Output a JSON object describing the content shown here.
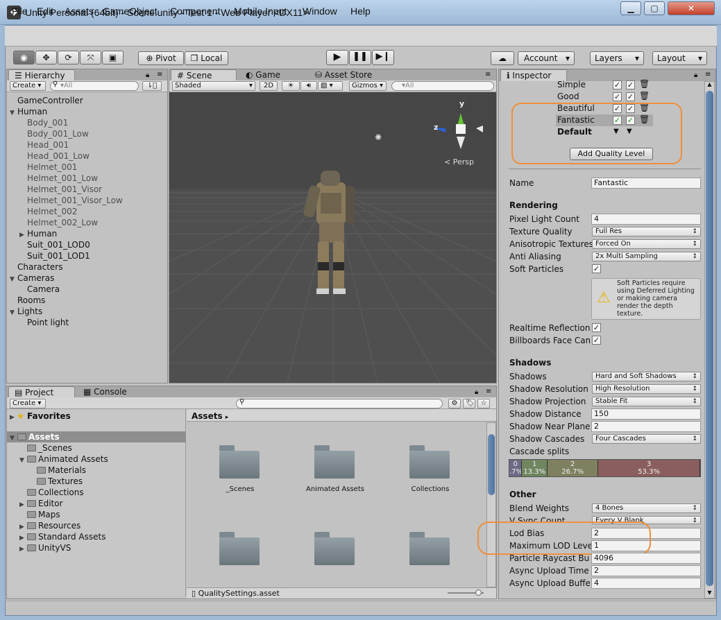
{
  "window": {
    "title": "Unity Personal (64bit) - Scene.unity - Test 1 - Web Player <DX11>",
    "minimize": "▁",
    "maximize": "▢",
    "close": "✕"
  },
  "menu": [
    "File",
    "Edit",
    "Assets",
    "GameObject",
    "Component",
    "Mobile Input",
    "Window",
    "Help"
  ],
  "toolbar": {
    "pivot": "Pivot",
    "local": "Local",
    "account": "Account",
    "layers": "Layers",
    "layout": "Layout"
  },
  "hierarchy": {
    "tab": "Hierarchy",
    "create": "Create",
    "search_placeholder": "▾All",
    "items": [
      {
        "label": "GameController",
        "indent": 0,
        "tri": ""
      },
      {
        "label": "Human",
        "indent": 0,
        "tri": "▼"
      },
      {
        "label": "Body_001",
        "indent": 2,
        "tri": "",
        "dim": true
      },
      {
        "label": "Body_001_Low",
        "indent": 2,
        "tri": "",
        "dim": true
      },
      {
        "label": "Head_001",
        "indent": 2,
        "tri": "",
        "dim": true
      },
      {
        "label": "Head_001_Low",
        "indent": 2,
        "tri": "",
        "dim": true
      },
      {
        "label": "Helmet_001",
        "indent": 2,
        "tri": "",
        "dim": true
      },
      {
        "label": "Helmet_001_Low",
        "indent": 2,
        "tri": "",
        "dim": true
      },
      {
        "label": "Helmet_001_Visor",
        "indent": 2,
        "tri": "",
        "dim": true
      },
      {
        "label": "Helmet_001_Visor_Low",
        "indent": 2,
        "tri": "",
        "dim": true
      },
      {
        "label": "Helmet_002",
        "indent": 2,
        "tri": "",
        "dim": true
      },
      {
        "label": "Helmet_002_Low",
        "indent": 2,
        "tri": "",
        "dim": true
      },
      {
        "label": "Human",
        "indent": 2,
        "tri": "▶"
      },
      {
        "label": "Suit_001_LOD0",
        "indent": 2,
        "tri": ""
      },
      {
        "label": "Suit_001_LOD1",
        "indent": 2,
        "tri": ""
      },
      {
        "label": "Characters",
        "indent": 0,
        "tri": ""
      },
      {
        "label": "Cameras",
        "indent": 0,
        "tri": "▼"
      },
      {
        "label": "Camera",
        "indent": 2,
        "tri": ""
      },
      {
        "label": "Rooms",
        "indent": 0,
        "tri": ""
      },
      {
        "label": "Lights",
        "indent": 0,
        "tri": "▼"
      },
      {
        "label": "Point light",
        "indent": 2,
        "tri": ""
      }
    ]
  },
  "scene": {
    "tabs": [
      "Scene",
      "Game",
      "Asset Store"
    ],
    "shaded": "Shaded",
    "mode2d": "2D",
    "gizmos": "Gizmos",
    "search_placeholder": "▾All",
    "persp": "Persp",
    "axis_y": "y",
    "axis_z": "z"
  },
  "inspector": {
    "tab": "Inspector",
    "quality_levels": [
      {
        "name": "Simple",
        "bold": false,
        "selected": false
      },
      {
        "name": "Good",
        "bold": false,
        "selected": false
      },
      {
        "name": "Beautiful",
        "bold": false,
        "selected": false
      },
      {
        "name": "Fantastic",
        "bold": false,
        "selected": true
      },
      {
        "name": "Default",
        "bold": true,
        "selected": false
      }
    ],
    "add_quality_level": "Add Quality Level",
    "name_label": "Name",
    "name_value": "Fantastic",
    "rendering": {
      "header": "Rendering",
      "pixel_light_count": {
        "label": "Pixel Light Count",
        "value": "4"
      },
      "texture_quality": {
        "label": "Texture Quality",
        "value": "Full Res"
      },
      "anisotropic": {
        "label": "Anisotropic Textures",
        "value": "Forced On"
      },
      "anti_aliasing": {
        "label": "Anti Aliasing",
        "value": "2x Multi Sampling"
      },
      "soft_particles": {
        "label": "Soft Particles",
        "checked": true
      },
      "warning": "Soft Particles require using Deferred Lighting or making camera render the depth texture.",
      "realtime_reflection": {
        "label": "Realtime Reflection P",
        "checked": true
      },
      "billboards": {
        "label": "Billboards Face Cam",
        "checked": true
      }
    },
    "shadows": {
      "header": "Shadows",
      "shadows": {
        "label": "Shadows",
        "value": "Hard and Soft Shadows"
      },
      "resolution": {
        "label": "Shadow Resolution",
        "value": "High Resolution"
      },
      "projection": {
        "label": "Shadow Projection",
        "value": "Stable Fit"
      },
      "distance": {
        "label": "Shadow Distance",
        "value": "150"
      },
      "near_plane": {
        "label": "Shadow Near Plane O",
        "value": "2"
      },
      "cascades": {
        "label": "Shadow Cascades",
        "value": "Four Cascades"
      },
      "splits_label": "Cascade splits",
      "splits": [
        {
          "index": "0",
          "pct": ".7%",
          "fraction": 0.067,
          "color": "#6d6a86"
        },
        {
          "index": "1",
          "pct": "13.3%",
          "fraction": 0.133,
          "color": "#6f8660"
        },
        {
          "index": "2",
          "pct": "26.7%",
          "fraction": 0.267,
          "color": "#7f8060"
        },
        {
          "index": "3",
          "pct": "53.3%",
          "fraction": 0.533,
          "color": "#8a5e5e"
        }
      ]
    },
    "other": {
      "header": "Other",
      "blend_weights": {
        "label": "Blend Weights",
        "value": "4 Bones"
      },
      "vsync": {
        "label": "V Sync Count",
        "value": "Every V Blank"
      },
      "lod_bias": {
        "label": "Lod Bias",
        "value": "2"
      },
      "max_lod": {
        "label": "Maximum LOD Level",
        "value": "1"
      },
      "particle_raycast": {
        "label": "Particle Raycast Bud",
        "value": "4096"
      },
      "async_time": {
        "label": "Async Upload Time S",
        "value": "2"
      },
      "async_buffer": {
        "label": "Async Upload Buffer",
        "value": "4"
      }
    }
  },
  "project": {
    "tabs": [
      "Project",
      "Console"
    ],
    "create": "Create",
    "favorites": "Favorites",
    "tree": [
      {
        "label": "Assets",
        "level": 0,
        "tri": "▼",
        "selected": true
      },
      {
        "label": "_Scenes",
        "level": 1,
        "tri": ""
      },
      {
        "label": "Animated Assets",
        "level": 1,
        "tri": "▼"
      },
      {
        "label": "Materials",
        "level": 2,
        "tri": ""
      },
      {
        "label": "Textures",
        "level": 2,
        "tri": ""
      },
      {
        "label": "Collections",
        "level": 1,
        "tri": ""
      },
      {
        "label": "Editor",
        "level": 1,
        "tri": "▶"
      },
      {
        "label": "Maps",
        "level": 1,
        "tri": ""
      },
      {
        "label": "Resources",
        "level": 1,
        "tri": "▶"
      },
      {
        "label": "Standard Assets",
        "level": 1,
        "tri": "▶"
      },
      {
        "label": "UnityVS",
        "level": 1,
        "tri": "▶"
      }
    ],
    "breadcrumb": "Assets",
    "folders": [
      "_Scenes",
      "Animated Assets",
      "Collections",
      "",
      "",
      ""
    ],
    "footer_file": "QualitySettings.asset",
    "zoom": 0.85
  }
}
